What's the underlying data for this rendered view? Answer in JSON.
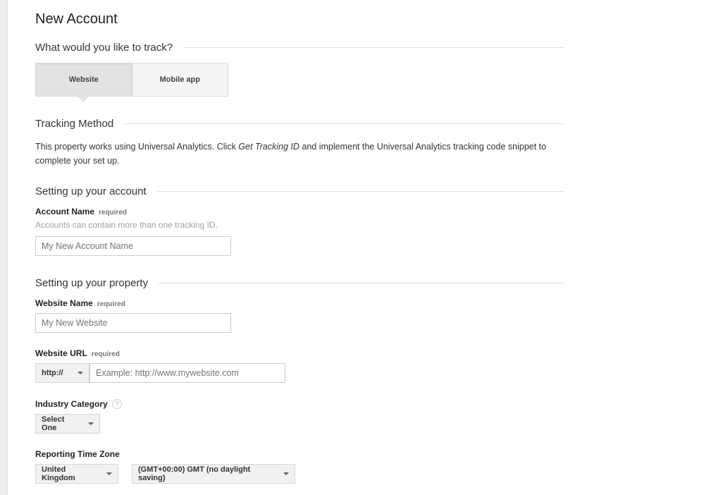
{
  "page": {
    "title": "New Account"
  },
  "track": {
    "heading": "What would you like to track?",
    "options": [
      {
        "label": "Website",
        "selected": true
      },
      {
        "label": "Mobile app",
        "selected": false
      }
    ]
  },
  "tracking_method": {
    "heading": "Tracking Method",
    "text_before": "This property works using Universal Analytics. Click ",
    "text_emphasis": "Get Tracking ID",
    "text_after": " and implement the Universal Analytics tracking code snippet to complete your set up."
  },
  "account": {
    "heading": "Setting up your account",
    "name_label": "Account Name",
    "required_label": "required",
    "hint": "Accounts can contain more than one tracking ID.",
    "name_placeholder": "My New Account Name"
  },
  "property": {
    "heading": "Setting up your property",
    "website_name_label": "Website Name",
    "website_name_placeholder": "My New Website",
    "website_url_label": "Website URL",
    "protocol_value": "http://",
    "url_placeholder": "Example: http://www.mywebsite.com",
    "industry_label": "Industry Category",
    "industry_help_icon": "?",
    "industry_value": "Select One",
    "timezone_label": "Reporting Time Zone",
    "country_value": "United Kingdom",
    "timezone_value": "(GMT+00:00) GMT (no daylight saving)",
    "required_label": "required"
  },
  "colors": {
    "background": "#ffffff",
    "rule": "#e0e0e0",
    "selected_toggle": "#e3e3e3",
    "dropdown_bg": "#f1f1f1"
  }
}
